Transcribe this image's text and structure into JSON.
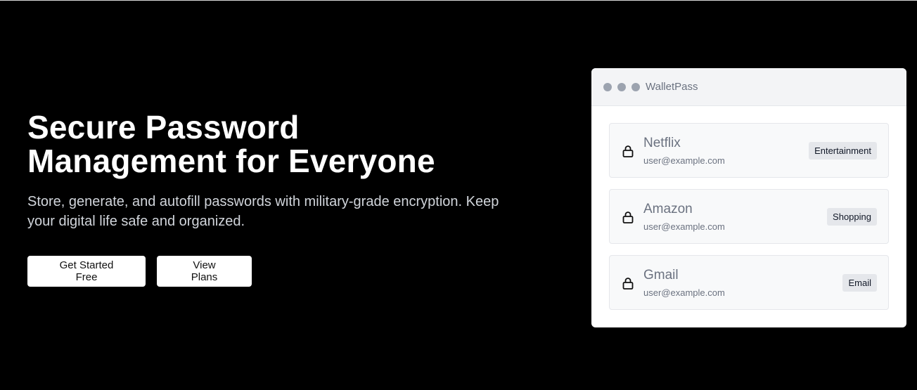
{
  "hero": {
    "title_line1": "Secure Password",
    "title_line2": "Management for Everyone",
    "subtitle": "Store, generate, and autofill passwords with military-grade encryption. Keep your digital life safe and organized.",
    "primary_button": "Get Started Free",
    "secondary_button": "View Plans"
  },
  "window": {
    "title": "WalletPass",
    "items": [
      {
        "name": "Netflix",
        "email": "user@example.com",
        "tag": "Entertainment",
        "icon": "lock-icon"
      },
      {
        "name": "Amazon",
        "email": "user@example.com",
        "tag": "Shopping",
        "icon": "lock-icon"
      },
      {
        "name": "Gmail",
        "email": "user@example.com",
        "tag": "Email",
        "icon": "lock-icon"
      }
    ]
  },
  "colors": {
    "background": "#000000",
    "button_bg": "#ffffff",
    "window_bg": "#ffffff",
    "titlebar_bg": "#f3f4f6",
    "dot": "#9ca3af",
    "item_bg": "#f8f9fa",
    "badge_bg": "#e5e7eb"
  }
}
